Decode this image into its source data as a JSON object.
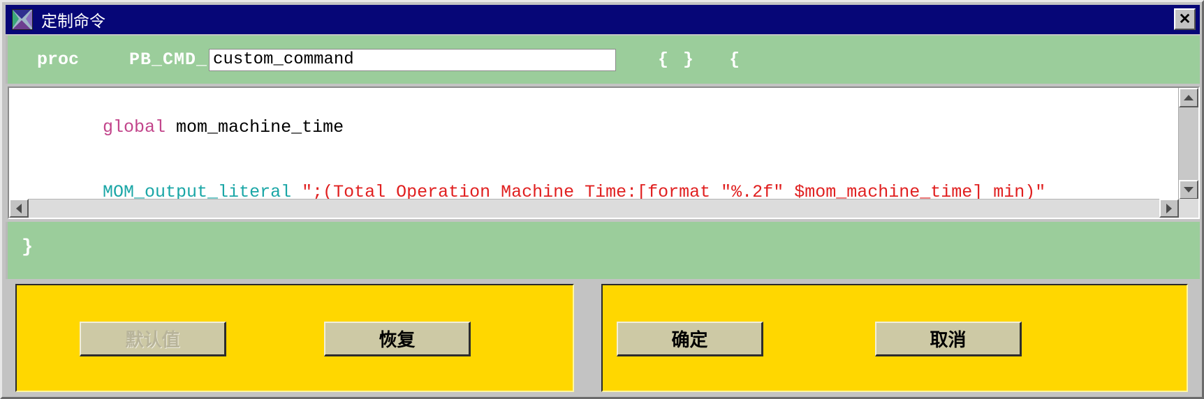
{
  "window": {
    "title": "定制命令",
    "icon": "app-hourglass-icon",
    "close_label": "✕",
    "colors": {
      "titlebar": "#060677",
      "panel_green": "#9bcd9b",
      "panel_yellow": "#ffd700",
      "button_face": "#cdc9a5",
      "frame": "#c3c3c3"
    }
  },
  "proc_row": {
    "keyword": "proc",
    "prefix": "PB_CMD_",
    "name_value": "custom_command",
    "name_placeholder": "custom_command",
    "args_braces": "{ }",
    "body_brace_open": "{"
  },
  "editor": {
    "lines": [
      {
        "tokens": [
          {
            "text": "global",
            "color": "#c2458b",
            "kind": "keyword"
          },
          {
            "text": " mom_machine_time",
            "color": "#000000",
            "kind": "plain"
          }
        ]
      },
      {
        "tokens": [
          {
            "text": "MOM_output_literal",
            "color": "#1aa6a6",
            "kind": "command"
          },
          {
            "text": " \";(Total Operation Machine Time:[format \"%.2f\" $mom_machine_time] min)\"",
            "color": "#e02020",
            "kind": "string"
          }
        ]
      }
    ],
    "scroll_up_icon": "arrow-up-icon",
    "scroll_down_icon": "arrow-down-icon",
    "scroll_left_icon": "arrow-left-icon",
    "scroll_right_icon": "arrow-right-icon"
  },
  "body_brace_close": "}",
  "buttons": {
    "left_panel": [
      {
        "id": "default",
        "label": "默认值",
        "disabled": true
      },
      {
        "id": "restore",
        "label": "恢复",
        "disabled": false
      }
    ],
    "right_panel": [
      {
        "id": "ok",
        "label": "确定",
        "disabled": false
      },
      {
        "id": "cancel",
        "label": "取消",
        "disabled": false
      }
    ]
  }
}
